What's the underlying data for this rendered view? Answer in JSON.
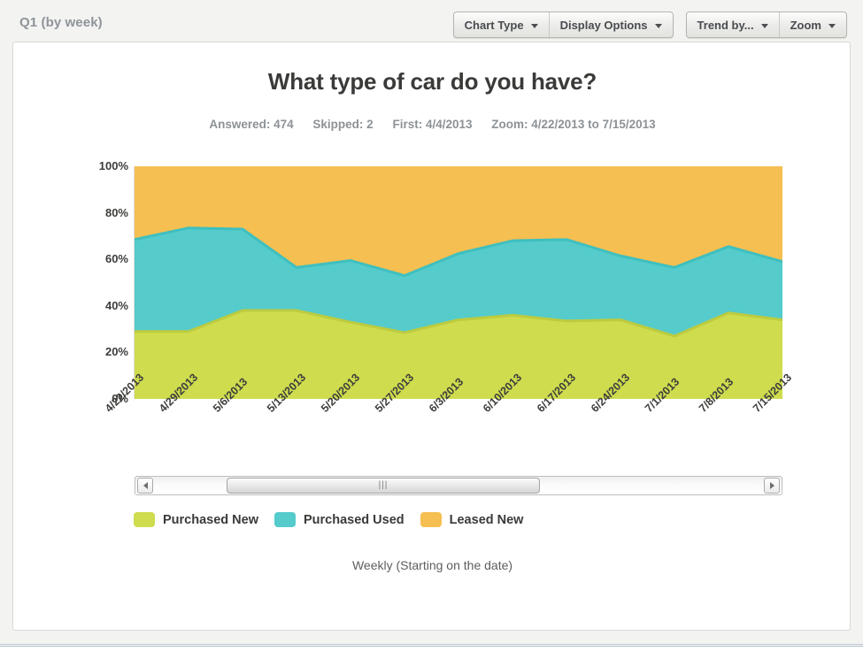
{
  "header": {
    "title": "Q1 (by week)",
    "button_groups": [
      {
        "buttons": [
          {
            "label": "Chart Type",
            "icon": "chevron-down-icon"
          },
          {
            "label": "Display Options",
            "icon": "chevron-down-icon"
          }
        ]
      },
      {
        "buttons": [
          {
            "label": "Trend by...",
            "icon": "chevron-down-icon"
          },
          {
            "label": "Zoom",
            "icon": "chevron-down-icon"
          }
        ]
      }
    ]
  },
  "chart_meta": {
    "answered": "Answered: 474",
    "skipped": "Skipped: 2",
    "first": "First: 4/4/2013",
    "zoom": "Zoom: 4/22/2013 to 7/15/2013"
  },
  "scrollbar": {
    "left_arrow": "scroll-left-icon",
    "right_arrow": "scroll-right-icon",
    "grip": "|||"
  },
  "axis_caption": "Weekly (Starting on the date)",
  "colors": {
    "purchased_new": "#cedc4e",
    "purchased_used": "#55cbcb",
    "leased_new": "#f5bf51",
    "purchased_new_stroke": "#bccb3f",
    "purchased_used_stroke": "#3fbfbf",
    "leased_new_stroke": "#f0b43c"
  },
  "chart_data": {
    "type": "area",
    "stacked": true,
    "normalized_percent": true,
    "title": "What type of car do you have?",
    "xlabel": "Weekly (Starting on the date)",
    "ylabel": "",
    "ylim": [
      0,
      100
    ],
    "yticks": [
      "0%",
      "20%",
      "40%",
      "60%",
      "80%",
      "100%"
    ],
    "ytick_values": [
      0,
      20,
      40,
      60,
      80,
      100
    ],
    "grid": false,
    "legend_position": "bottom-left",
    "categories": [
      "4/22/2013",
      "4/29/2013",
      "5/6/2013",
      "5/13/2013",
      "5/20/2013",
      "5/27/2013",
      "6/3/2013",
      "6/10/2013",
      "6/17/2013",
      "6/24/2013",
      "7/1/2013",
      "7/8/2013",
      "7/15/2013"
    ],
    "series": [
      {
        "name": "Purchased New",
        "color": "#cedc4e",
        "values": [
          29,
          29,
          38,
          38,
          33,
          28.5,
          34,
          36,
          33.5,
          34,
          27,
          37,
          34
        ]
      },
      {
        "name": "Purchased Used",
        "color": "#55cbcb",
        "values": [
          39.5,
          44.5,
          35,
          18.5,
          26.5,
          24.5,
          28.5,
          32,
          35,
          27.5,
          29.5,
          28.5,
          25
        ]
      },
      {
        "name": "Leased New",
        "color": "#f5bf51",
        "values": [
          31.5,
          26.5,
          27,
          43.5,
          40.5,
          47,
          37.5,
          32,
          31.5,
          38.5,
          43.5,
          34.5,
          41
        ]
      }
    ],
    "cumulative_tops": {
      "purchased_new": [
        29,
        29,
        38,
        38,
        33,
        28.5,
        34,
        36,
        33.5,
        34,
        27,
        37,
        34
      ],
      "purchased_used": [
        68.5,
        73.5,
        73,
        56.5,
        59.5,
        53,
        62.5,
        68,
        68.5,
        61.5,
        56.5,
        65.5,
        59
      ]
    }
  }
}
